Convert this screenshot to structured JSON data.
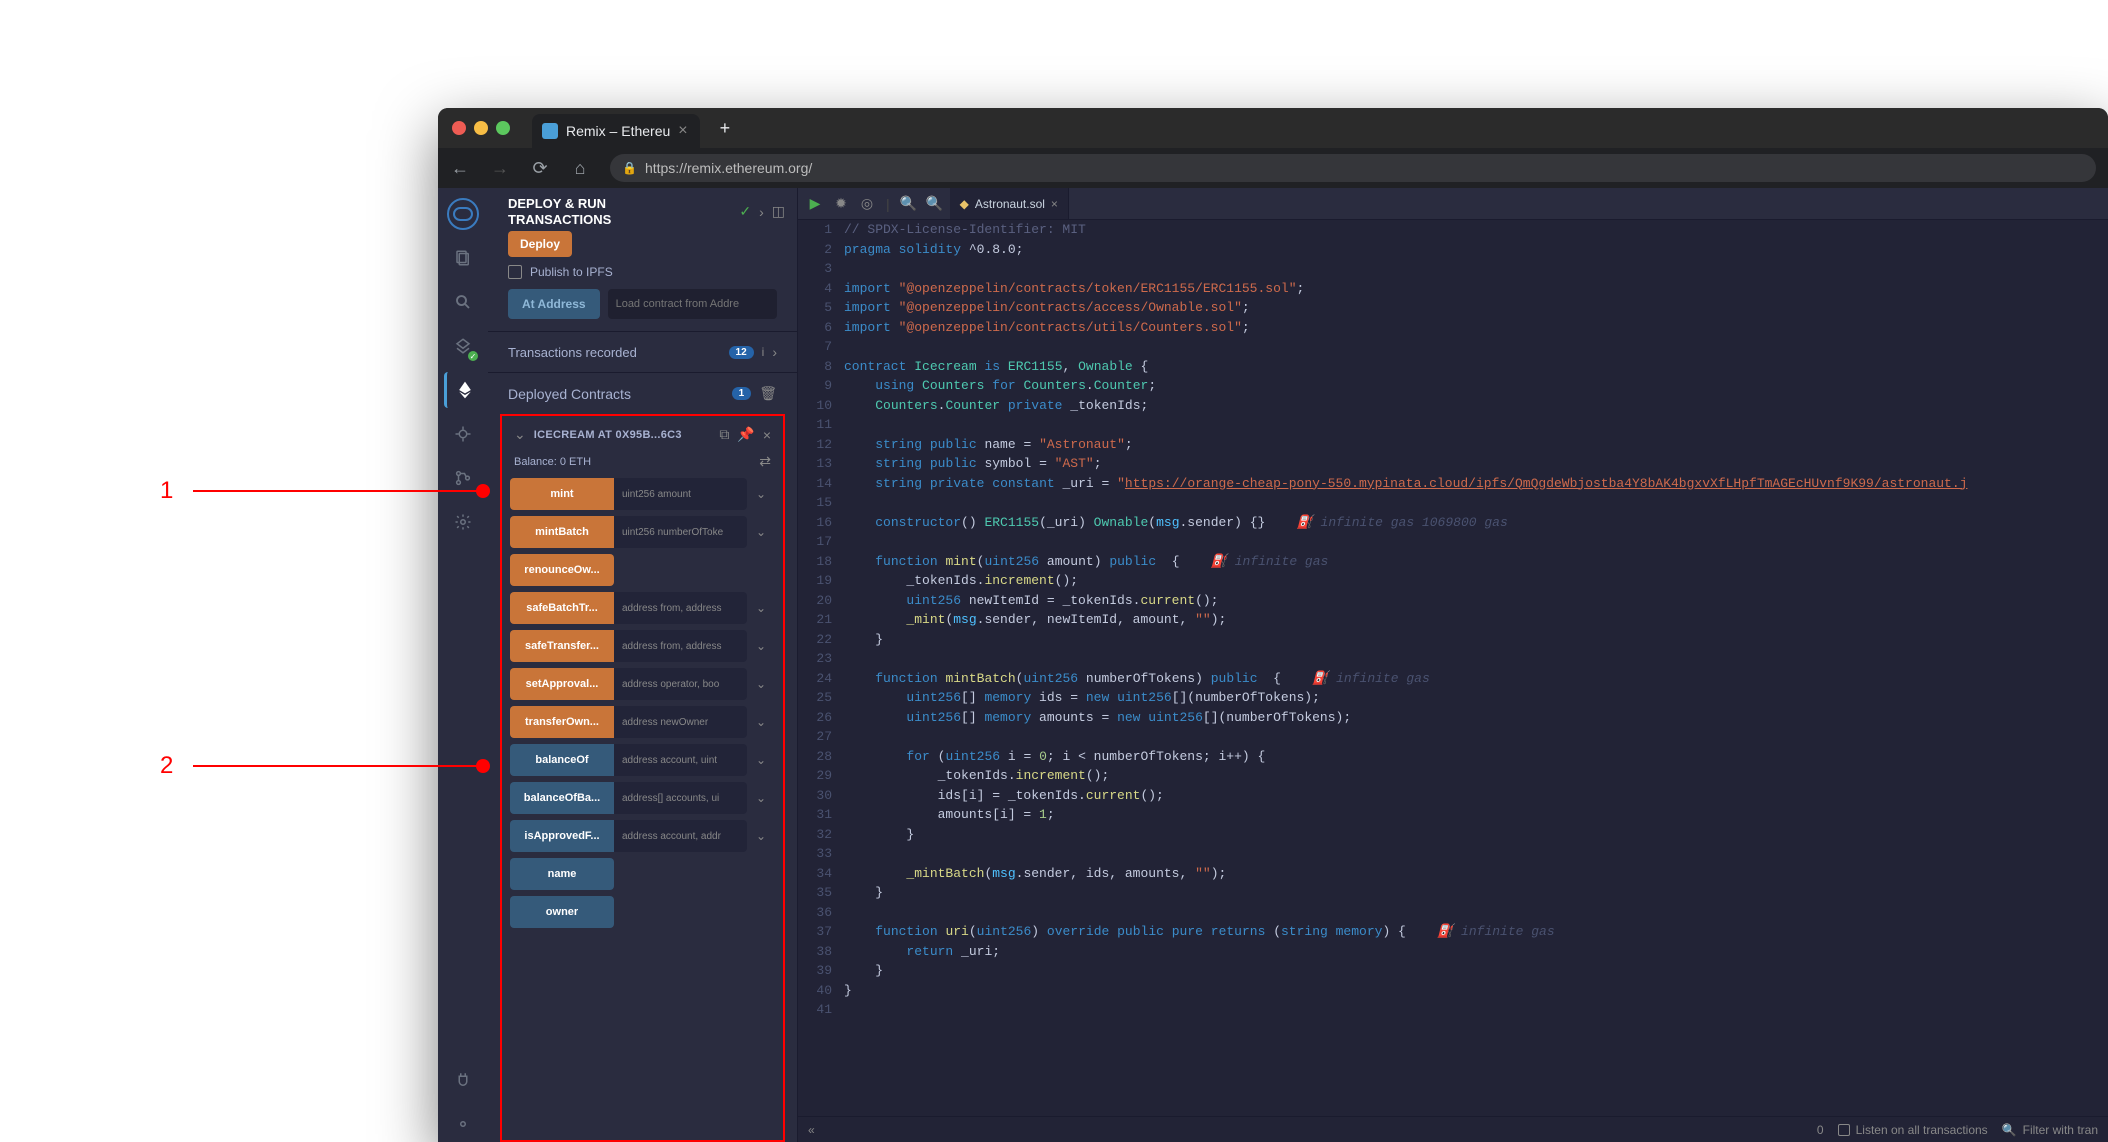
{
  "annotations": {
    "a1": "1",
    "a2": "2"
  },
  "browser": {
    "tab_title": "Remix – Ethereu",
    "url": "https://remix.ethereum.org/"
  },
  "panel": {
    "title1": "DEPLOY & RUN",
    "title2": "TRANSACTIONS",
    "deploy": "Deploy",
    "publish_ipfs": "Publish to IPFS",
    "at_address": "At Address",
    "load_placeholder": "Load contract from Addre",
    "tx_recorded": "Transactions recorded",
    "tx_badge": "12",
    "deployed_label": "Deployed Contracts",
    "deployed_badge": "1",
    "contract": {
      "name": "ICECREAM AT 0X95B...6C3",
      "balance_label": "Balance:",
      "balance_value": "0 ETH"
    },
    "functions": [
      {
        "label": "mint",
        "color": "orange",
        "placeholder": "uint256 amount",
        "expand": true
      },
      {
        "label": "mintBatch",
        "color": "orange",
        "placeholder": "uint256 numberOfToke",
        "expand": true
      },
      {
        "label": "renounceOw...",
        "color": "orange",
        "placeholder": "",
        "expand": false,
        "noinput": true
      },
      {
        "label": "safeBatchTr...",
        "color": "orange",
        "placeholder": "address from, address",
        "expand": true
      },
      {
        "label": "safeTransfer...",
        "color": "orange",
        "placeholder": "address from, address",
        "expand": true
      },
      {
        "label": "setApproval...",
        "color": "orange",
        "placeholder": "address operator, boo",
        "expand": true
      },
      {
        "label": "transferOwn...",
        "color": "orange",
        "placeholder": "address newOwner",
        "expand": true
      },
      {
        "label": "balanceOf",
        "color": "blue",
        "placeholder": "address account, uint",
        "expand": true
      },
      {
        "label": "balanceOfBa...",
        "color": "blue",
        "placeholder": "address[] accounts, ui",
        "expand": true
      },
      {
        "label": "isApprovedF...",
        "color": "blue",
        "placeholder": "address account, addr",
        "expand": true
      },
      {
        "label": "name",
        "color": "blue",
        "placeholder": "",
        "expand": false,
        "noinput": true
      },
      {
        "label": "owner",
        "color": "blue",
        "placeholder": "",
        "expand": false,
        "noinput": true
      }
    ]
  },
  "editor": {
    "filename": "Astronaut.sol",
    "footer_count": "0",
    "footer_listen": "Listen on all transactions",
    "footer_filter": "Filter with tran"
  },
  "code_lines": [
    "<span class='c-comment'>// SPDX-License-Identifier: MIT</span>",
    "<span class='c-kw'>pragma</span> <span class='c-kw'>solidity</span> ^0.8.0;",
    "",
    "<span class='c-kw'>import</span> <span class='c-str'>\"@openzeppelin/contracts/token/ERC1155/ERC1155.sol\"</span>;",
    "<span class='c-kw'>import</span> <span class='c-str'>\"@openzeppelin/contracts/access/Ownable.sol\"</span>;",
    "<span class='c-kw'>import</span> <span class='c-str'>\"@openzeppelin/contracts/utils/Counters.sol\"</span>;",
    "",
    "<span class='c-kw'>contract</span> <span class='c-type'>Icecream</span> <span class='c-kw'>is</span> <span class='c-type'>ERC1155</span>, <span class='c-type'>Ownable</span> {",
    "    <span class='c-kw'>using</span> <span class='c-type'>Counters</span> <span class='c-kw'>for</span> <span class='c-type'>Counters</span>.<span class='c-type'>Counter</span>;",
    "    <span class='c-type'>Counters</span>.<span class='c-type'>Counter</span> <span class='c-kw'>private</span> _tokenIds;",
    "",
    "    <span class='c-kw'>string</span> <span class='c-kw'>public</span> name = <span class='c-str'>\"Astronaut\"</span>;",
    "    <span class='c-kw'>string</span> <span class='c-kw'>public</span> symbol = <span class='c-str'>\"AST\"</span>;",
    "    <span class='c-kw'>string</span> <span class='c-kw'>private</span> <span class='c-kw'>constant</span> _uri = <span class='c-str'>\"<span class='c-link'>https://orange-cheap-pony-550.mypinata.cloud/ipfs/QmQgdeWbjostba4Y8bAK4bgxvXfLHpfTmAGEcHUvnf9K99/astronaut.j</span></span>",
    "",
    "    <span class='c-kw'>constructor</span>() <span class='c-type'>ERC1155</span>(_uri) <span class='c-type'>Ownable</span>(<span class='c-const'>msg</span>.sender) {}    <span class='c-gas'>⛽ infinite gas 1069800 gas</span>",
    "",
    "    <span class='c-kw'>function</span> <span class='c-fn'>mint</span>(<span class='c-kw'>uint256</span> amount) <span class='c-kw'>public</span>  {    <span class='c-gas'>⛽ infinite gas</span>",
    "        _tokenIds.<span class='c-fn'>increment</span>();",
    "        <span class='c-kw'>uint256</span> newItemId = _tokenIds.<span class='c-fn'>current</span>();",
    "        <span class='c-fn'>_mint</span>(<span class='c-const'>msg</span>.sender, newItemId, amount, <span class='c-str'>\"\"</span>);",
    "    }",
    "",
    "    <span class='c-kw'>function</span> <span class='c-fn'>mintBatch</span>(<span class='c-kw'>uint256</span> numberOfTokens) <span class='c-kw'>public</span>  {    <span class='c-gas'>⛽ infinite gas</span>",
    "        <span class='c-kw'>uint256</span>[] <span class='c-kw'>memory</span> ids = <span class='c-kw'>new</span> <span class='c-kw'>uint256</span>[](numberOfTokens);",
    "        <span class='c-kw'>uint256</span>[] <span class='c-kw'>memory</span> amounts = <span class='c-kw'>new</span> <span class='c-kw'>uint256</span>[](numberOfTokens);",
    "",
    "        <span class='c-kw'>for</span> (<span class='c-kw'>uint256</span> i = <span class='c-num'>0</span>; i &lt; numberOfTokens; i++) {",
    "            _tokenIds.<span class='c-fn'>increment</span>();",
    "            ids[i] = _tokenIds.<span class='c-fn'>current</span>();",
    "            amounts[i] = <span class='c-num'>1</span>;",
    "        }",
    "",
    "        <span class='c-fn'>_mintBatch</span>(<span class='c-const'>msg</span>.sender, ids, amounts, <span class='c-str'>\"\"</span>);",
    "    }",
    "",
    "    <span class='c-kw'>function</span> <span class='c-fn'>uri</span>(<span class='c-kw'>uint256</span>) <span class='c-kw'>override</span> <span class='c-kw'>public</span> <span class='c-kw'>pure</span> <span class='c-kw'>returns</span> (<span class='c-kw'>string</span> <span class='c-kw'>memory</span>) {    <span class='c-gas'>⛽ infinite gas</span>",
    "        <span class='c-kw'>return</span> _uri;",
    "    }",
    "}",
    ""
  ]
}
